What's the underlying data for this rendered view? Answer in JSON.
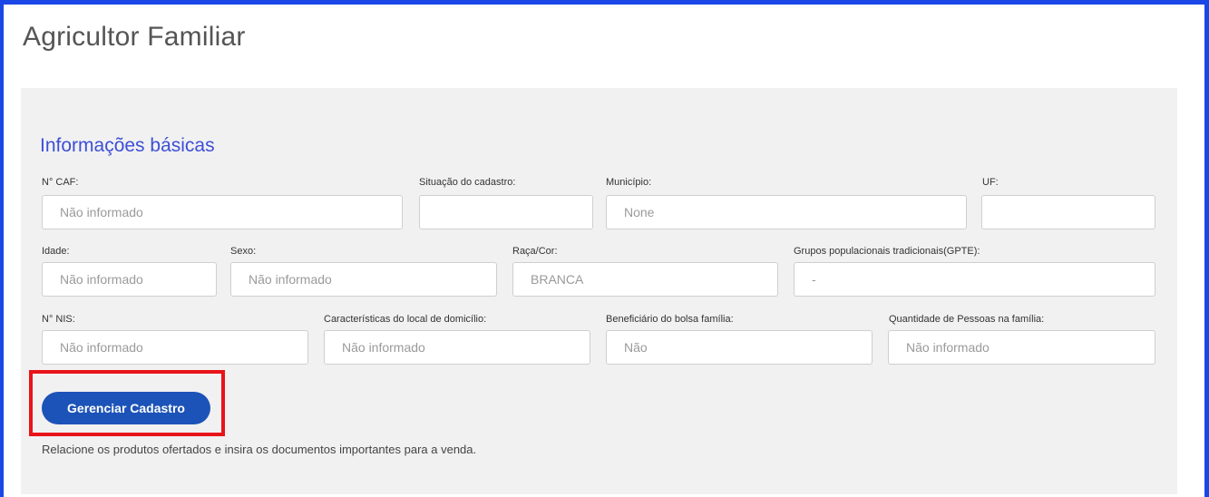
{
  "page": {
    "title": "Agricultor Familiar"
  },
  "section": {
    "title": "Informações básicas"
  },
  "fields": {
    "caf": {
      "label": "N° CAF:",
      "value": "Não informado"
    },
    "situacao": {
      "label": "Situação do cadastro:",
      "value": ""
    },
    "municipio": {
      "label": "Município:",
      "value": "None"
    },
    "uf": {
      "label": "UF:",
      "value": ""
    },
    "idade": {
      "label": "Idade:",
      "value": "Não informado"
    },
    "sexo": {
      "label": "Sexo:",
      "value": "Não informado"
    },
    "raca": {
      "label": "Raça/Cor:",
      "value": "BRANCA"
    },
    "gpte": {
      "label": "Grupos populacionais tradicionais(GPTE):",
      "value": "-"
    },
    "nis": {
      "label": "N° NIS:",
      "value": "Não informado"
    },
    "local": {
      "label": "Características do local de domicílio:",
      "value": "Não informado"
    },
    "bolsa": {
      "label": "Beneficiário do bolsa família:",
      "value": "Não"
    },
    "pessoas": {
      "label": "Quantidade de Pessoas na família:",
      "value": "Não informado"
    }
  },
  "actions": {
    "manage_label": "Gerenciar Cadastro"
  },
  "help": {
    "text": "Relacione os produtos ofertados e insira os documentos importantes para a venda."
  },
  "colors": {
    "frame": "#1a47e6",
    "section_title": "#3d4fd6",
    "button": "#1c53b8",
    "highlight": "#e8141a",
    "panel": "#f1f1f1"
  }
}
